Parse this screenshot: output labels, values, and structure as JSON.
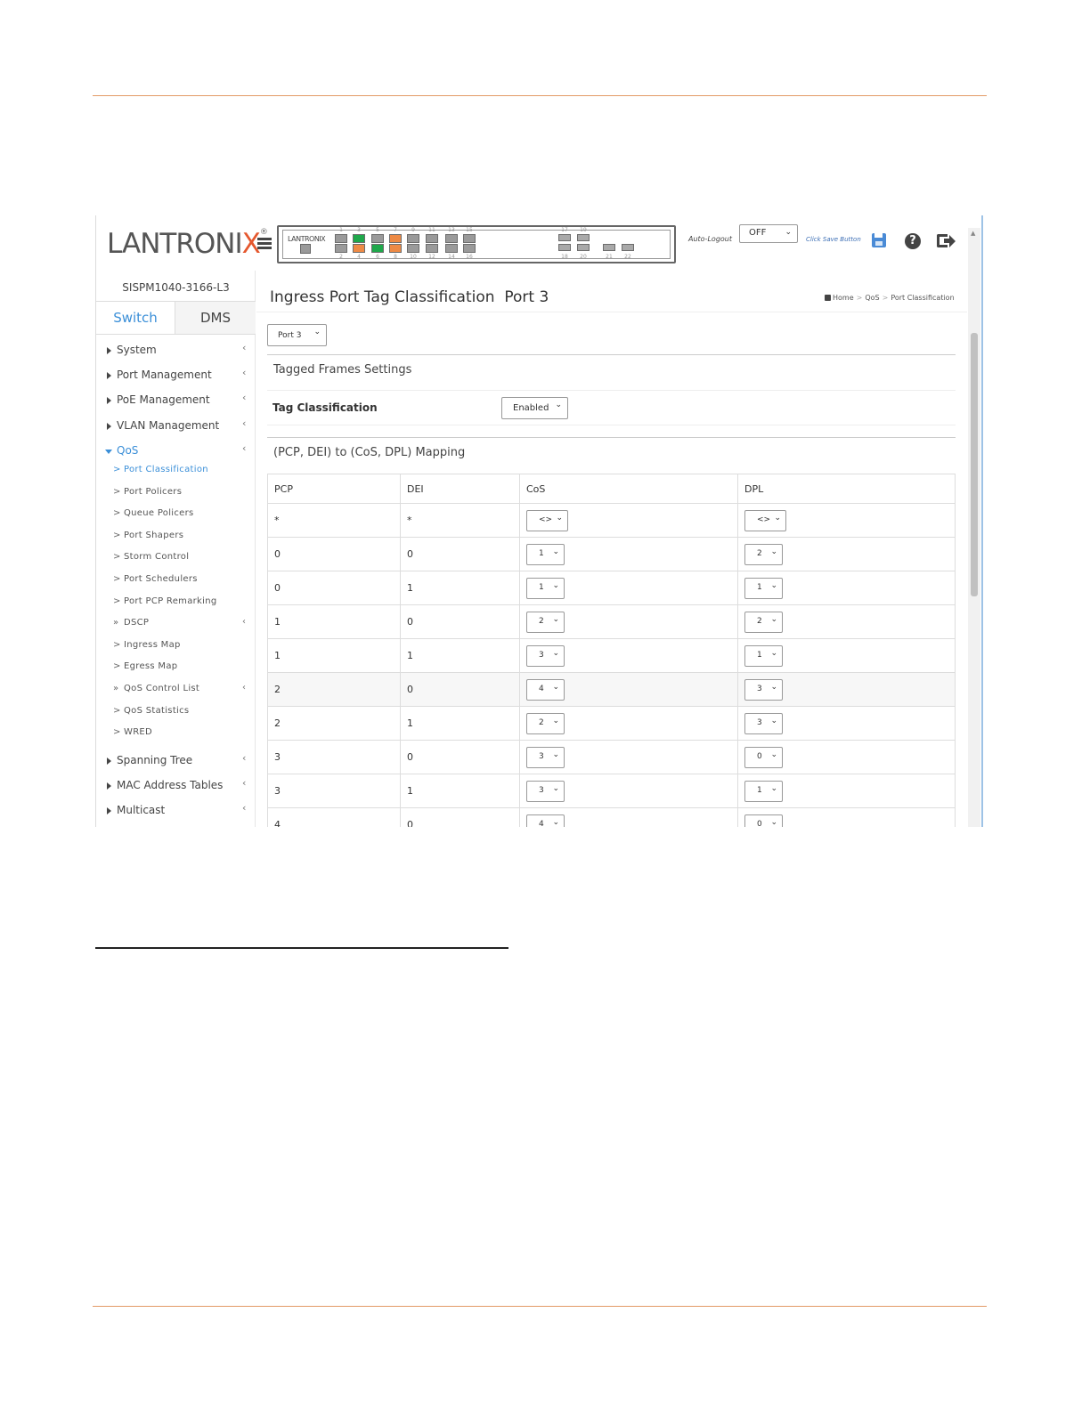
{
  "header": {
    "logo_text": "LANTRONIX",
    "panel_brand": "LANTRONIX",
    "ports_top": [
      "1",
      "3",
      "5",
      "7",
      "9",
      "11",
      "13",
      "15",
      "17",
      "19"
    ],
    "ports_bottom": [
      "2",
      "4",
      "6",
      "8",
      "10",
      "12",
      "14",
      "16",
      "18",
      "20",
      "21",
      "22"
    ],
    "auto_logout_label": "Auto-Logout",
    "auto_logout_value": "OFF",
    "save_hint": "Click Save Button",
    "icons": [
      "menu-icon",
      "save-icon",
      "help-icon",
      "logout-icon"
    ]
  },
  "sidebar": {
    "device_name": "SISPM1040-3166-L3",
    "tabs": [
      "Switch",
      "DMS"
    ],
    "items": [
      {
        "label": "System"
      },
      {
        "label": "Port Management"
      },
      {
        "label": "PoE Management"
      },
      {
        "label": "VLAN Management"
      },
      {
        "label": "QoS"
      },
      {
        "label": "Spanning Tree"
      },
      {
        "label": "MAC Address Tables"
      },
      {
        "label": "Multicast"
      }
    ],
    "qos_sub": [
      {
        "label": "Port Classification",
        "marker": ">"
      },
      {
        "label": "Port Policers",
        "marker": ">"
      },
      {
        "label": "Queue Policers",
        "marker": ">"
      },
      {
        "label": "Port Shapers",
        "marker": ">"
      },
      {
        "label": "Storm Control",
        "marker": ">"
      },
      {
        "label": "Port Schedulers",
        "marker": ">"
      },
      {
        "label": "Port PCP Remarking",
        "marker": ">"
      },
      {
        "label": "DSCP",
        "marker": "»"
      },
      {
        "label": "Ingress Map",
        "marker": ">"
      },
      {
        "label": "Egress Map",
        "marker": ">"
      },
      {
        "label": "QoS Control List",
        "marker": "»"
      },
      {
        "label": "QoS Statistics",
        "marker": ">"
      },
      {
        "label": "WRED",
        "marker": ">"
      }
    ]
  },
  "main": {
    "title": "Ingress Port Tag Classification",
    "title_port": "Port 3",
    "breadcrumb": [
      "Home",
      "QoS",
      "Port Classification"
    ],
    "port_select": "Port 3",
    "tagged_section_title": "Tagged Frames Settings",
    "tag_classification_label": "Tag Classification",
    "tag_classification_value": "Enabled",
    "mapping_section_title": "(PCP, DEI) to (CoS, DPL) Mapping",
    "columns": [
      "PCP",
      "DEI",
      "CoS",
      "DPL"
    ],
    "rows": [
      {
        "pcp": "*",
        "dei": "*",
        "cos": "<>",
        "dpl": "<>"
      },
      {
        "pcp": "0",
        "dei": "0",
        "cos": "1",
        "dpl": "2"
      },
      {
        "pcp": "0",
        "dei": "1",
        "cos": "1",
        "dpl": "1"
      },
      {
        "pcp": "1",
        "dei": "0",
        "cos": "2",
        "dpl": "2"
      },
      {
        "pcp": "1",
        "dei": "1",
        "cos": "3",
        "dpl": "1"
      },
      {
        "pcp": "2",
        "dei": "0",
        "cos": "4",
        "dpl": "3"
      },
      {
        "pcp": "2",
        "dei": "1",
        "cos": "2",
        "dpl": "3"
      },
      {
        "pcp": "3",
        "dei": "0",
        "cos": "3",
        "dpl": "0"
      },
      {
        "pcp": "3",
        "dei": "1",
        "cos": "3",
        "dpl": "1"
      },
      {
        "pcp": "4",
        "dei": "0",
        "cos": "4",
        "dpl": "0"
      }
    ]
  },
  "colors": {
    "accent": "#3b8fd8",
    "rule": "#e39a66",
    "logo_x": "#e5572d",
    "port_green": "#1fa84b",
    "port_orange": "#ee8a45"
  }
}
